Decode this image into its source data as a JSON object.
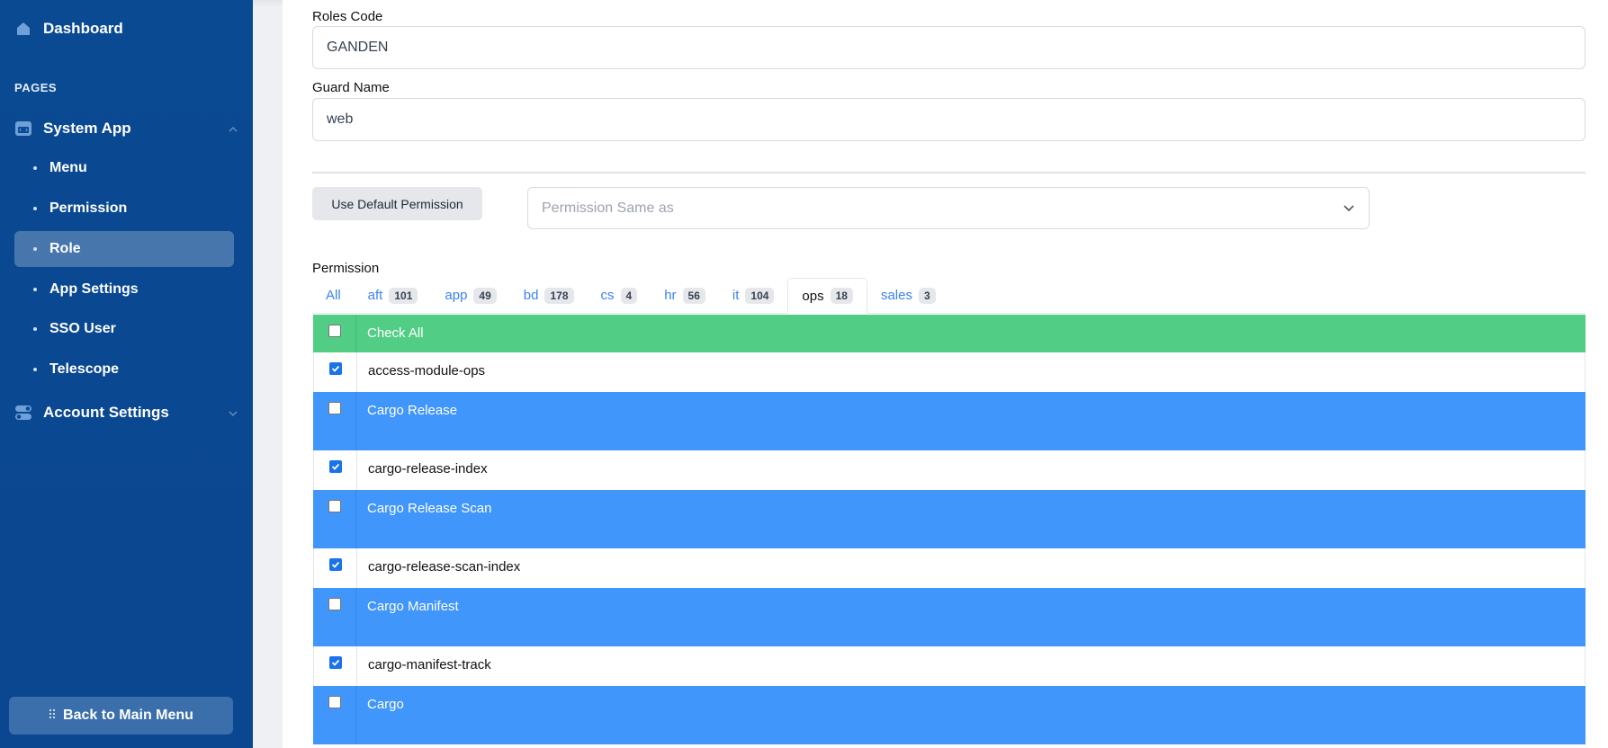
{
  "sidebar": {
    "dashboard": "Dashboard",
    "section": "PAGES",
    "system_app": "System App",
    "items": [
      {
        "label": "Menu"
      },
      {
        "label": "Permission"
      },
      {
        "label": "Role"
      },
      {
        "label": "App Settings"
      },
      {
        "label": "SSO User"
      },
      {
        "label": "Telescope"
      }
    ],
    "account_settings": "Account Settings",
    "back": "Back to Main Menu"
  },
  "form": {
    "roles_code_label": "Roles Code",
    "roles_code_value": "GANDEN",
    "guard_name_label": "Guard Name",
    "guard_name_value": "web",
    "default_button": "Use Default Permission",
    "same_as_placeholder": "Permission Same as",
    "permission_label": "Permission"
  },
  "tabs": [
    {
      "label": "All",
      "count": ""
    },
    {
      "label": "aft",
      "count": "101"
    },
    {
      "label": "app",
      "count": "49"
    },
    {
      "label": "bd",
      "count": "178"
    },
    {
      "label": "cs",
      "count": "4"
    },
    {
      "label": "hr",
      "count": "56"
    },
    {
      "label": "it",
      "count": "104"
    },
    {
      "label": "ops",
      "count": "18"
    },
    {
      "label": "sales",
      "count": "3"
    }
  ],
  "table": {
    "check_all": "Check All",
    "rows": [
      {
        "type": "item",
        "label": "access-module-ops",
        "checked": true
      },
      {
        "type": "group",
        "label": "Cargo Release",
        "checked": false
      },
      {
        "type": "item",
        "label": "cargo-release-index",
        "checked": true
      },
      {
        "type": "group",
        "label": "Cargo Release Scan",
        "checked": false
      },
      {
        "type": "item",
        "label": "cargo-release-scan-index",
        "checked": true
      },
      {
        "type": "group",
        "label": "Cargo Manifest",
        "checked": false
      },
      {
        "type": "item",
        "label": "cargo-manifest-track",
        "checked": true
      },
      {
        "type": "group",
        "label": "Cargo",
        "checked": false
      }
    ]
  },
  "colors": {
    "sidebar": "#0a4a93",
    "check_all_row": "#52cd85",
    "group_row": "#4096fb",
    "link": "#3b82f6"
  }
}
